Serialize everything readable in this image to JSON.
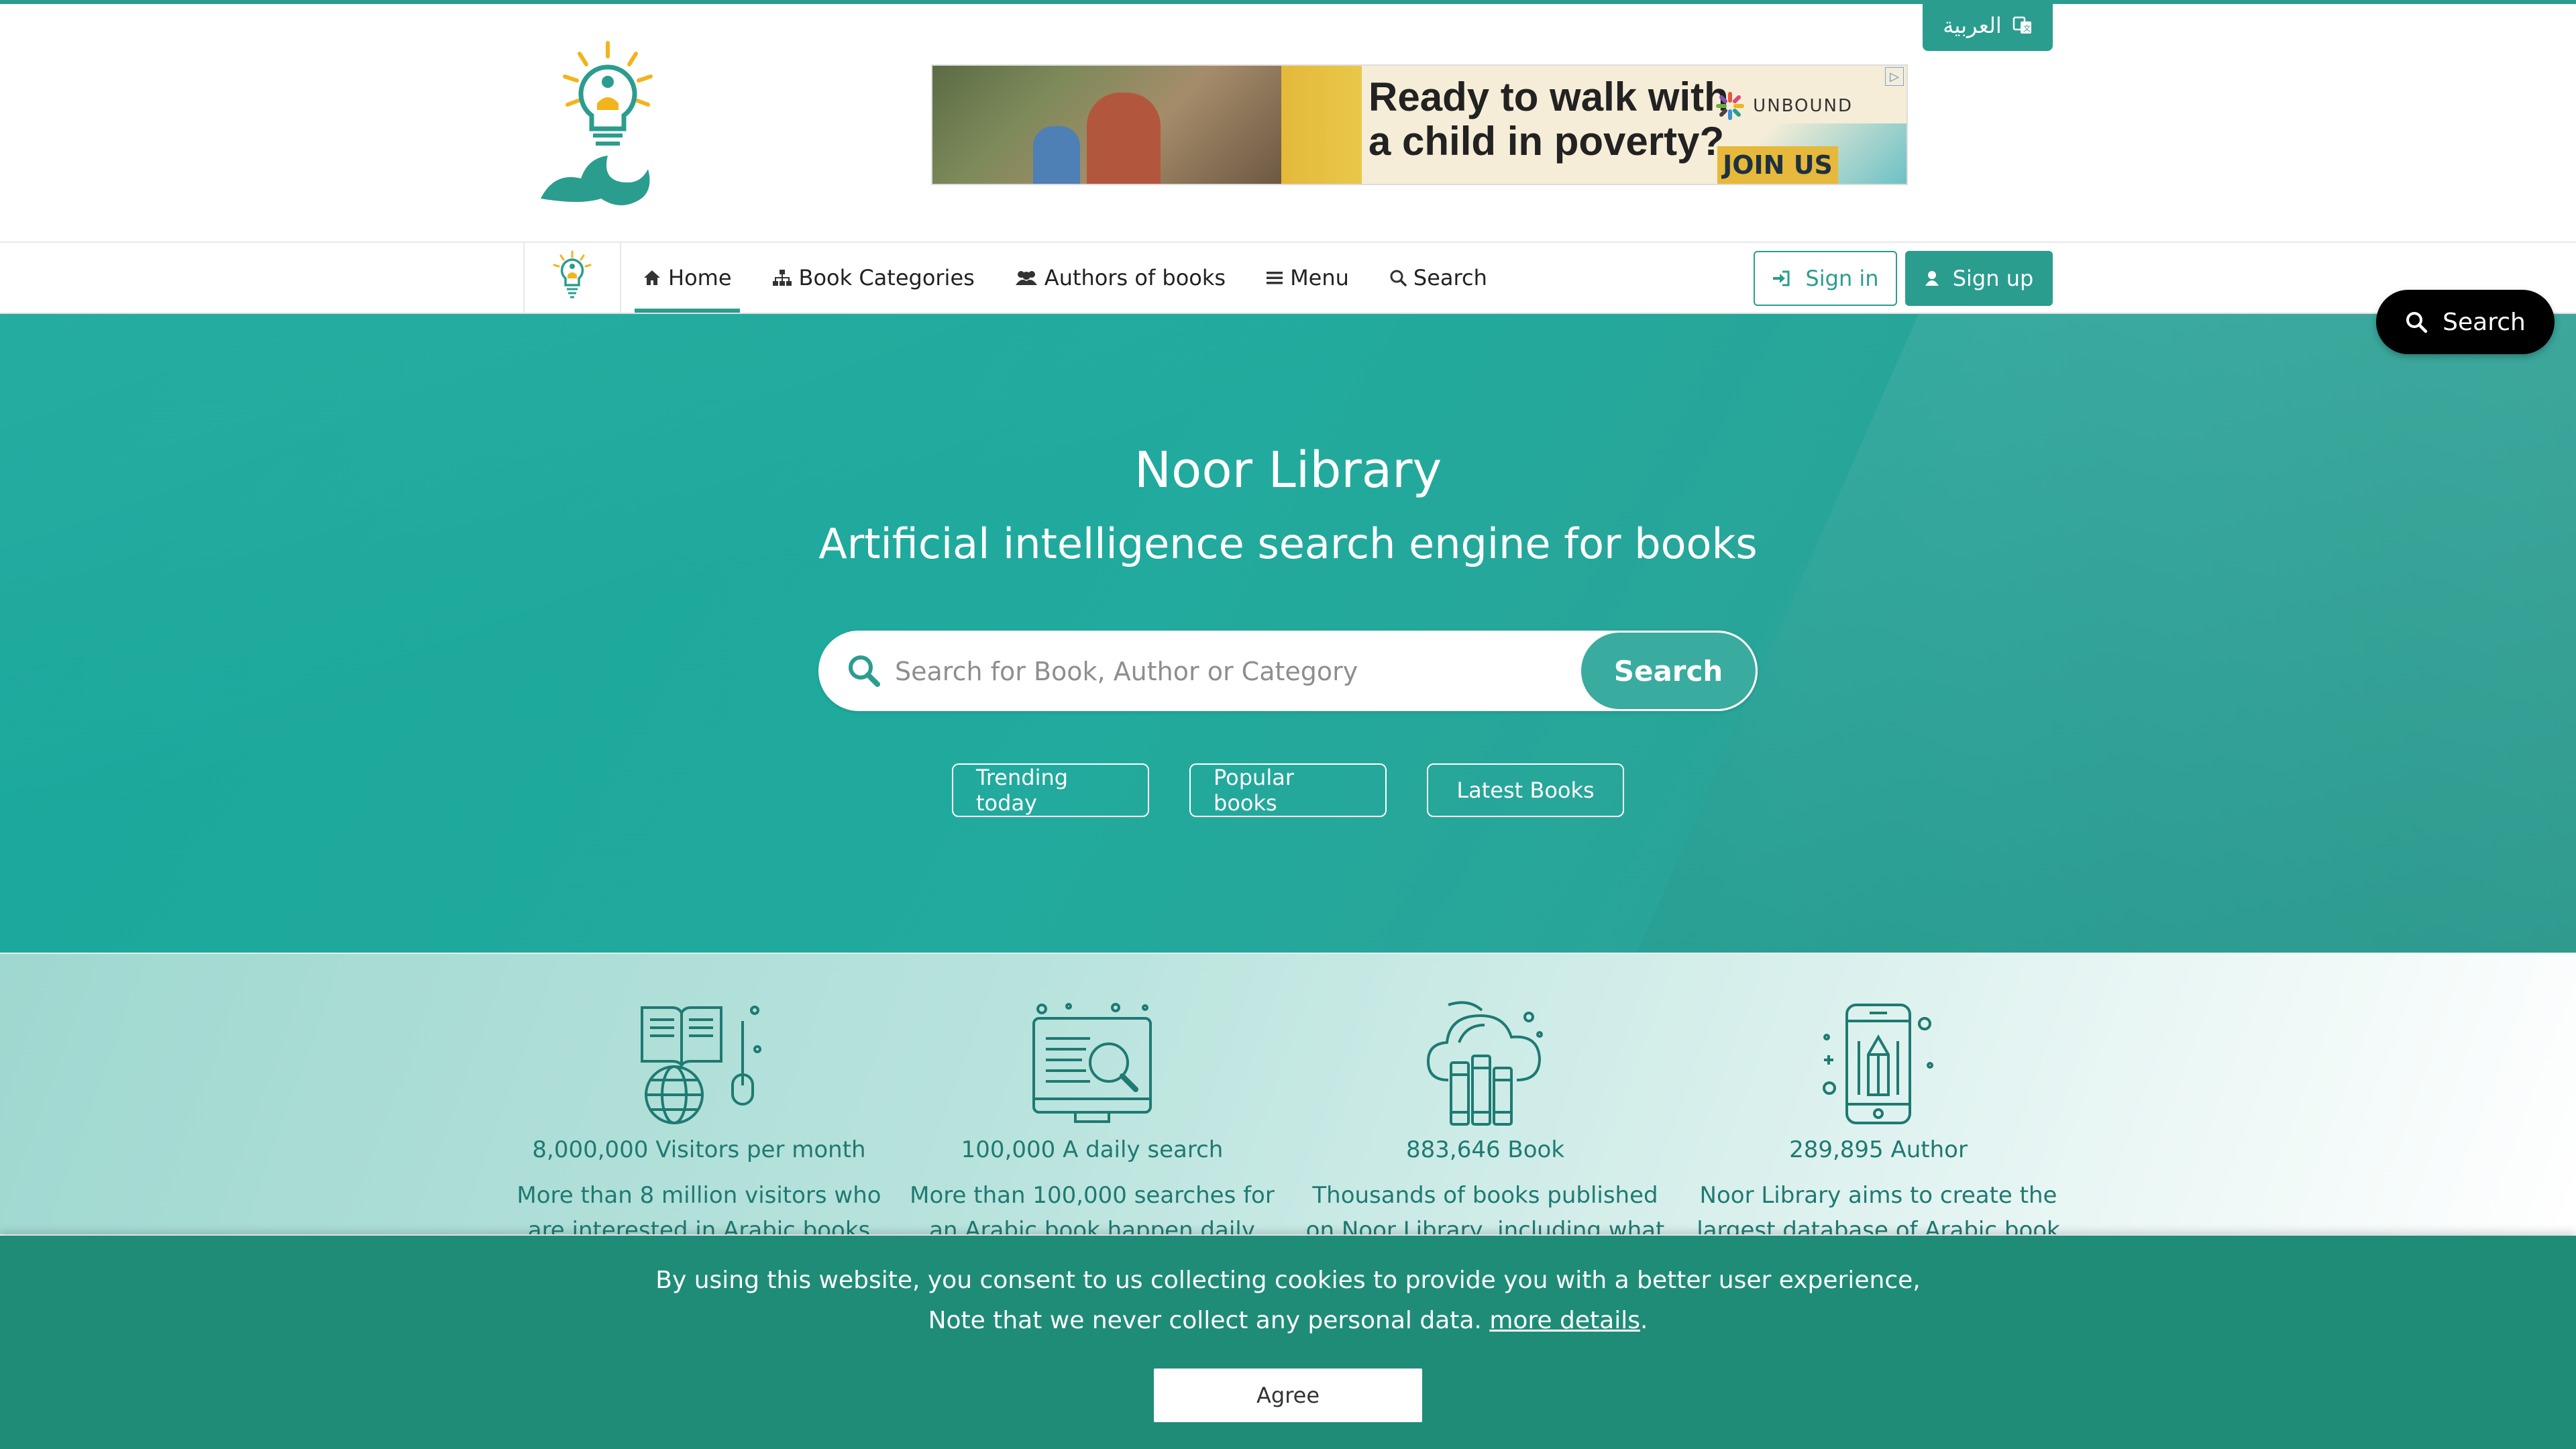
{
  "language_button": {
    "label": "العربية",
    "icon": "translate-icon"
  },
  "logo": {
    "alt": "مكتبة نور",
    "icon": "lightbulb-reader-logo"
  },
  "ad": {
    "headline": "Ready to walk with\na child in poverty?",
    "brand": "UNBOUND",
    "cta": "JOIN US",
    "badge": "▷"
  },
  "nav": {
    "items": [
      {
        "label": "Home",
        "icon": "home-icon",
        "active": true
      },
      {
        "label": "Book Categories",
        "icon": "sitemap-icon",
        "active": false
      },
      {
        "label": "Authors of books",
        "icon": "users-icon",
        "active": false
      },
      {
        "label": "Menu",
        "icon": "bars-icon",
        "active": false
      },
      {
        "label": "Search",
        "icon": "search-icon",
        "active": false
      }
    ],
    "sign_in": "Sign in",
    "sign_up": "Sign up"
  },
  "floating_search": {
    "label": "Search"
  },
  "hero": {
    "title": "Noor Library",
    "subtitle": "Artificial intelligence search engine for books",
    "search": {
      "placeholder": "Search for Book, Author or Category",
      "value": "",
      "button": "Search"
    },
    "pills": [
      "Trending today",
      "Popular books",
      "Latest Books"
    ]
  },
  "stats": [
    {
      "icon": "book-globe-icon",
      "title": "8,000,000 Visitors per month",
      "desc": "More than 8 million visitors who are interested in Arabic books"
    },
    {
      "icon": "monitor-search-icon",
      "title": "100,000 A daily search",
      "desc": "More than 100,000 searches for an Arabic book happen daily"
    },
    {
      "icon": "cloud-books-icon",
      "title": "883,646 Book",
      "desc": "Thousands of books published on Noor Library, including what"
    },
    {
      "icon": "phone-pencil-icon",
      "title": "289,895 Author",
      "desc": "Noor Library aims to create the largest database of Arabic book"
    }
  ],
  "cookie": {
    "line1": "By using this website, you consent to us collecting cookies to provide you with a better user experience,",
    "line2_prefix": "Note that we never collect any personal data.",
    "link": "more details",
    "line2_suffix": ".",
    "agree": "Agree"
  },
  "colors": {
    "brand": "#2a9d8f",
    "cookie_bg": "#1f8c78",
    "floating": "#000000"
  }
}
